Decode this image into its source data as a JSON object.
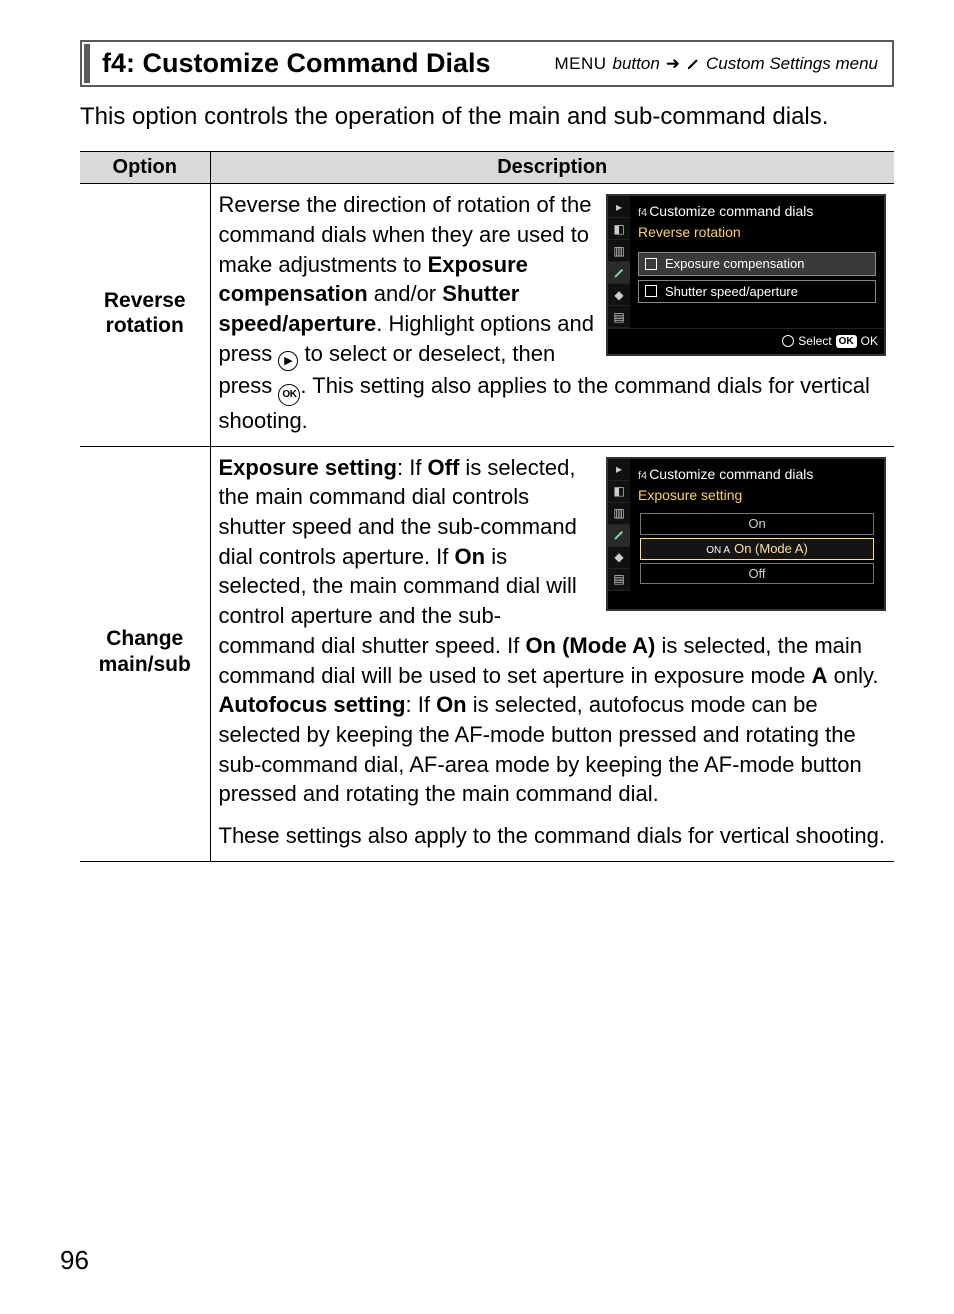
{
  "header": {
    "title": "f4: Customize Command Dials",
    "menu_label": "MENU",
    "button_word": "button",
    "path_suffix": "Custom Settings menu"
  },
  "intro": "This option controls the operation of the main and sub-command dials.",
  "table": {
    "headers": {
      "option": "Option",
      "description": "Description"
    },
    "rows": [
      {
        "option_line1": "Reverse",
        "option_line2": "rotation",
        "desc": {
          "p1_a": "Reverse the direction of rotation of the command dials when they are used to make adjustments to ",
          "p1_bold1": "Exposure compensation",
          "p1_b": " and/or ",
          "p1_bold2": "Shutter speed/aperture",
          "p1_c": ".  Highlight options and press ",
          "p1_d": " to select or deselect, then press ",
          "p1_e": ".  This setting also applies to the command dials for vertical shooting."
        },
        "lcd": {
          "prefix": "f4",
          "title": "Customize command dials",
          "subtitle": "Reverse rotation",
          "items": [
            "Exposure compensation",
            "Shutter speed/aperture"
          ],
          "footer_select": "Select",
          "footer_ok": "OK"
        }
      },
      {
        "option_line1": "Change",
        "option_line2": "main/sub",
        "desc": {
          "exp_label": "Exposure setting",
          "exp_a": ": If ",
          "exp_off": "Off",
          "exp_b": " is selected, the main command dial controls shutter speed and the sub-command dial controls aperture.  If ",
          "exp_on": "On",
          "exp_c": " is selected, the main command dial will control aperture and the sub-command dial shutter speed.  If ",
          "exp_on_modeA": "On (Mode A)",
          "exp_d": " is selected, the main command dial will be used to set aperture in exposure mode ",
          "exp_modeA": "A",
          "exp_e": " only.",
          "af_label": "Autofocus setting",
          "af_a": ": If ",
          "af_on": "On",
          "af_b": " is selected, autofocus mode can be selected by keeping the AF-mode button pressed and rotating the sub-command dial, AF-area mode by keeping the AF-mode button pressed and rotating the main command dial.",
          "tail": "These settings also apply to the command dials for vertical shooting."
        },
        "lcd": {
          "prefix": "f4",
          "title": "Customize command dials",
          "subtitle": "Exposure setting",
          "opts": [
            {
              "label": "On",
              "highlight": false
            },
            {
              "label": "On (Mode A)",
              "highlight": true,
              "prefix": "ON A"
            },
            {
              "label": "Off",
              "highlight": false
            }
          ]
        }
      }
    ]
  },
  "icons": {
    "right_press": "▶",
    "ok_label": "OK"
  },
  "page_number": "96"
}
